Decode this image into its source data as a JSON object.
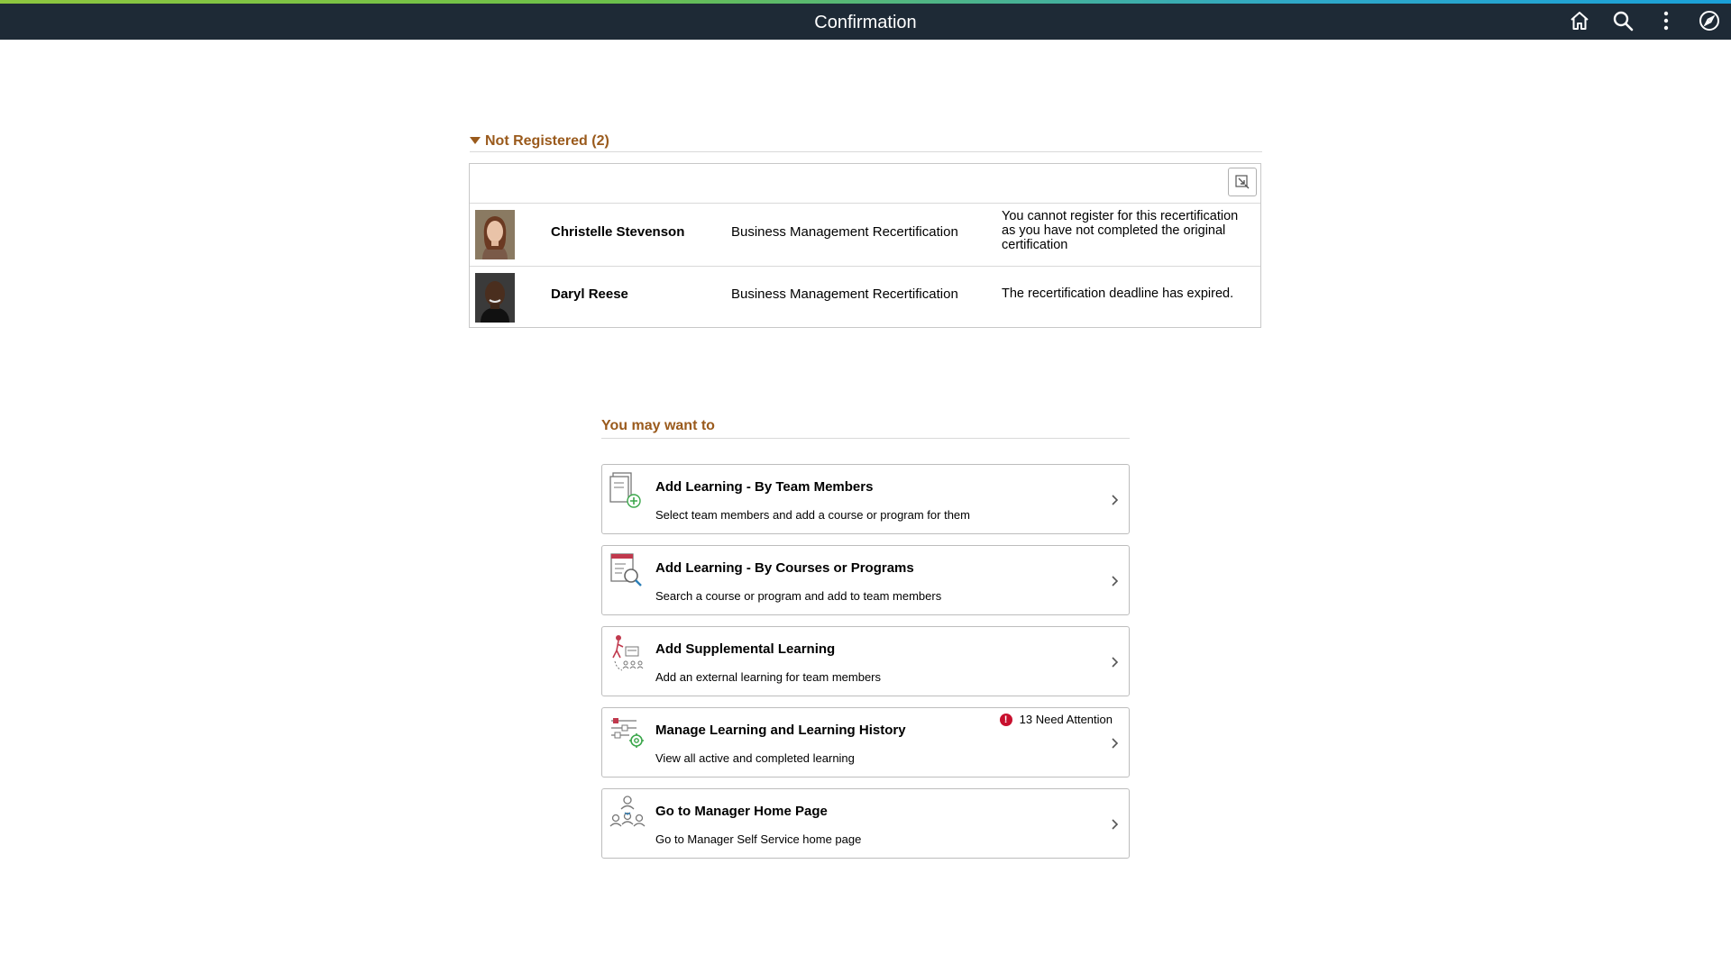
{
  "header": {
    "title": "Confirmation",
    "icons": [
      "home-icon",
      "search-icon",
      "more-options-icon",
      "navbar-compass-icon"
    ]
  },
  "not_registered": {
    "label": "Not Registered (2)",
    "rows": [
      {
        "name": "Christelle Stevenson",
        "course": "Business Management Recertification",
        "reason": "You cannot register for this recertification as you have not completed the original certification"
      },
      {
        "name": "Daryl Reese",
        "course": "Business Management Recertification",
        "reason": "The recertification deadline has expired."
      }
    ]
  },
  "may_want": {
    "label": "You may want to",
    "cards": [
      {
        "title": "Add Learning - By Team Members",
        "desc": "Select team members and add a course or program for them",
        "icon": "add-learning-team-icon"
      },
      {
        "title": "Add Learning - By Courses or Programs",
        "desc": "Search a course or program and add to team members",
        "icon": "search-courses-icon"
      },
      {
        "title": "Add Supplemental Learning",
        "desc": "Add an external learning for team members",
        "icon": "supplemental-learning-icon"
      },
      {
        "title": "Manage Learning and Learning History",
        "desc": "View all active and completed learning",
        "icon": "manage-learning-icon",
        "attention": "13 Need Attention"
      },
      {
        "title": "Go to Manager Home Page",
        "desc": "Go to Manager Self Service home page",
        "icon": "manager-team-icon"
      }
    ]
  },
  "colors": {
    "header_bg": "#1e2a36",
    "section_label": "#9a5a1c",
    "alert": "#c8102e"
  }
}
